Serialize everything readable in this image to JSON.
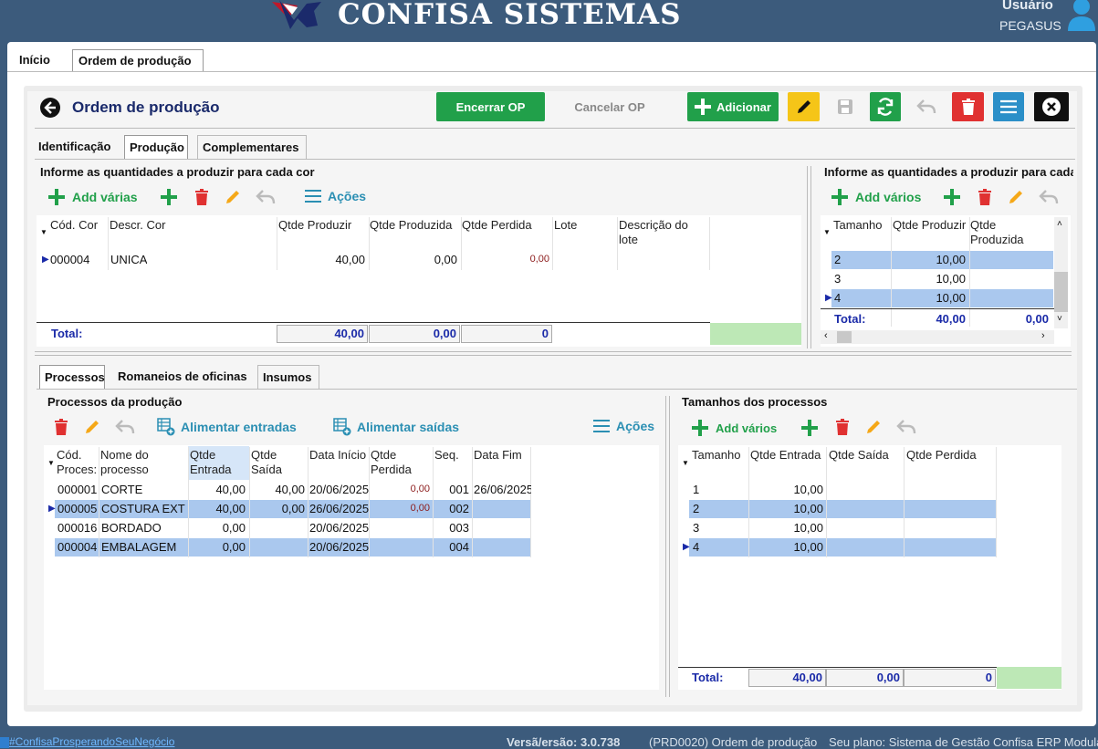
{
  "app": {
    "brand": "CONFISA SISTEMAS",
    "user_label": "Usuário",
    "user_name": "PEGASUS"
  },
  "tabs": [
    {
      "label": "Início"
    },
    {
      "label": "Ordem de produção"
    }
  ],
  "header": {
    "title": "Ordem de produção",
    "encerrar": "Encerrar OP",
    "cancelar": "Cancelar OP",
    "adicionar": "Adicionar"
  },
  "subtabs": [
    "Identificação",
    "Produção",
    "Complementares"
  ],
  "cores": {
    "title": "Informe as quantidades a produzir para cada cor",
    "add": "Add várias",
    "acoes": "Ações",
    "columns": [
      "Cód. Cor",
      "Descr. Cor",
      "Qtde Produzir",
      "Qtde Produzida",
      "Qtde Perdida",
      "Lote",
      "Descrição do lote"
    ],
    "rows": [
      {
        "cod": "000004",
        "descr": "UNICA",
        "produzir": "40,00",
        "produzida": "0,00",
        "perdida": "0,00"
      }
    ],
    "total_label": "Total:",
    "total_produzir": "40,00",
    "total_produzida": "0,00",
    "total_perdida": "0"
  },
  "tamanhos_top": {
    "title": "Informe as quantidades a produzir para cada",
    "add": "Add vários",
    "columns": [
      "Tamanho",
      "Qtde Produzir",
      "Qtde Produzida"
    ],
    "rows": [
      {
        "tam": "2",
        "produzir": "10,00"
      },
      {
        "tam": "3",
        "produzir": "10,00"
      },
      {
        "tam": "4",
        "produzir": "10,00"
      }
    ],
    "total_label": "Total:",
    "total_produzir": "40,00",
    "total_produzida": "0,00"
  },
  "lower_tabs": [
    "Processos",
    "Romaneios de oficinas",
    "Insumos"
  ],
  "processos": {
    "title": "Processos da produção",
    "alimentar_entradas": "Alimentar entradas",
    "alimentar_saidas": "Alimentar saídas",
    "acoes": "Ações",
    "columns": [
      "Cód. Proces:",
      "Nome do processo",
      "Qtde Entrada",
      "Qtde Saída",
      "Data Início",
      "Qtde Perdida",
      "Seq.",
      "Data Fim"
    ],
    "rows": [
      {
        "cod": "000001",
        "nome": "CORTE",
        "entrada": "40,00",
        "saida": "40,00",
        "inicio": "20/06/2025",
        "perdida": "0,00",
        "seq": "001",
        "fim": "26/06/2025"
      },
      {
        "cod": "000005",
        "nome": "COSTURA EXT",
        "entrada": "40,00",
        "saida": "0,00",
        "inicio": "26/06/2025",
        "perdida": "0,00",
        "seq": "002",
        "fim": ""
      },
      {
        "cod": "000016",
        "nome": "BORDADO",
        "entrada": "0,00",
        "saida": "",
        "inicio": "20/06/2025",
        "perdida": "",
        "seq": "003",
        "fim": ""
      },
      {
        "cod": "000004",
        "nome": "EMBALAGEM",
        "entrada": "0,00",
        "saida": "",
        "inicio": "20/06/2025",
        "perdida": "",
        "seq": "004",
        "fim": ""
      }
    ]
  },
  "tamanhos_proc": {
    "title": "Tamanhos dos processos",
    "add": "Add vários",
    "columns": [
      "Tamanho",
      "Qtde Entrada",
      "Qtde Saída",
      "Qtde Perdida"
    ],
    "rows": [
      {
        "tam": "1",
        "entrada": "10,00"
      },
      {
        "tam": "2",
        "entrada": "10,00"
      },
      {
        "tam": "3",
        "entrada": "10,00"
      },
      {
        "tam": "4",
        "entrada": "10,00"
      }
    ],
    "total_label": "Total:",
    "total_entrada": "40,00",
    "total_saida": "0,00",
    "total_perdida": "0"
  },
  "footer": {
    "hashtag": "#ConfisaProsperandoSeuNegócio",
    "versao": "Versã/ersão: 3.0.738",
    "tela": "(PRD0020) Ordem de produção",
    "plano": "Seu plano: Sistema de Gestão Confisa ERP Modular"
  },
  "colors": {
    "accent_green": "#21a04a",
    "selected_row": "#aac8ee",
    "header_bg": "#3c5b7c"
  }
}
